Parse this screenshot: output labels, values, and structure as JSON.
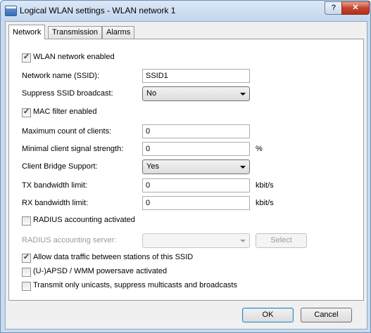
{
  "window": {
    "title": "Logical WLAN settings - WLAN network 1",
    "help_label": "?",
    "close_label": "✕"
  },
  "tabs": [
    "Network",
    "Transmission",
    "Alarms"
  ],
  "active_tab": "Network",
  "form": {
    "wlan_enabled": {
      "label": "WLAN network enabled",
      "checked": true
    },
    "ssid": {
      "label": "Network name (SSID):",
      "value": "SSID1"
    },
    "suppress_ssid": {
      "label": "Suppress SSID broadcast:",
      "value": "No"
    },
    "mac_filter": {
      "label": "MAC filter enabled",
      "checked": true
    },
    "max_clients": {
      "label": "Maximum count of clients:",
      "value": "0"
    },
    "min_signal": {
      "label": "Minimal client signal strength:",
      "value": "0",
      "unit": "%"
    },
    "client_bridge": {
      "label": "Client Bridge Support:",
      "value": "Yes"
    },
    "tx_limit": {
      "label": "TX bandwidth limit:",
      "value": "0",
      "unit": "kbit/s"
    },
    "rx_limit": {
      "label": "RX bandwidth limit:",
      "value": "0",
      "unit": "kbit/s"
    },
    "radius_accounting": {
      "label": "RADIUS accounting activated",
      "checked": false
    },
    "radius_server": {
      "label": "RADIUS accounting server:",
      "value": "",
      "select_label": "Select"
    },
    "allow_traffic": {
      "label": "Allow data traffic between stations of this SSID",
      "checked": true
    },
    "uapsd": {
      "label": "(U-)APSD / WMM powersave activated",
      "checked": false
    },
    "unicast_only": {
      "label": "Transmit only unicasts, suppress multicasts and broadcasts",
      "checked": false
    }
  },
  "footer": {
    "ok_label": "OK",
    "cancel_label": "Cancel"
  }
}
